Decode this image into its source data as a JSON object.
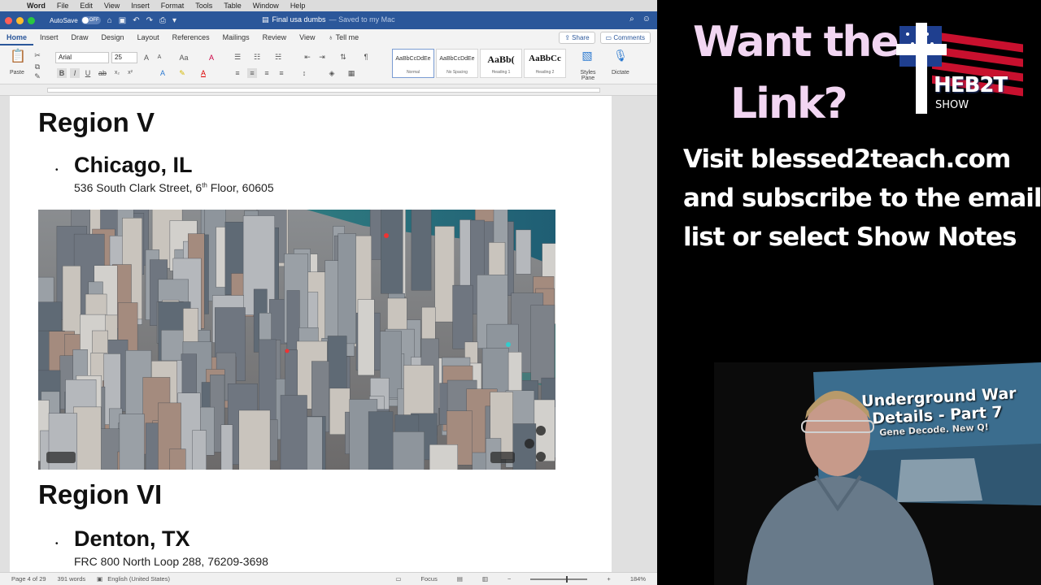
{
  "menubar": {
    "app": "Word",
    "items": [
      "File",
      "Edit",
      "View",
      "Insert",
      "Format",
      "Tools",
      "Table",
      "Window",
      "Help"
    ]
  },
  "titlebar": {
    "autosave_label": "AutoSave",
    "autosave_state": "OFF",
    "doc_name": "Final usa dumbs",
    "saved_status": "— Saved to my Mac"
  },
  "tabs": [
    "Home",
    "Insert",
    "Draw",
    "Design",
    "Layout",
    "References",
    "Mailings",
    "Review",
    "View"
  ],
  "tell_me": "Tell me",
  "share_label": "Share",
  "comments_label": "Comments",
  "ribbon": {
    "paste_label": "Paste",
    "font_name": "Arial",
    "font_size": "25",
    "styles": [
      {
        "preview": "AaBbCcDdEe",
        "name": "Normal"
      },
      {
        "preview": "AaBbCcDdEe",
        "name": "No Spacing"
      },
      {
        "preview": "AaBb(",
        "name": "Heading 1"
      },
      {
        "preview": "AaBbCc",
        "name": "Heading 2"
      }
    ],
    "styles_pane_label": "Styles Pane",
    "dictate_label": "Dictate"
  },
  "document": {
    "region1_title": "Region V",
    "region1_city": "Chicago, IL",
    "region1_address_pre": "536 South Clark Street, 6",
    "region1_address_sup": "th",
    "region1_address_post": " Floor, 60605",
    "region2_title": "Region VI",
    "region2_city": "Denton, TX",
    "region2_address": "FRC 800 North Loop 288, 76209-3698"
  },
  "statusbar": {
    "page": "Page 4 of 29",
    "words": "391 words",
    "language": "English (United States)",
    "focus": "Focus",
    "zoom": "184%"
  },
  "promo": {
    "line1": "Want the",
    "line2": "Link?",
    "body1": "Visit blessed2teach.com",
    "body2": "and subscribe to the email",
    "body3": "list or select Show Notes",
    "logo_text": "HEB2T",
    "logo_sub": "SHOW",
    "tv_line1": "Underground War",
    "tv_line2": "Details - Part 7",
    "tv_line3": "Gene Decode. New Q!"
  }
}
